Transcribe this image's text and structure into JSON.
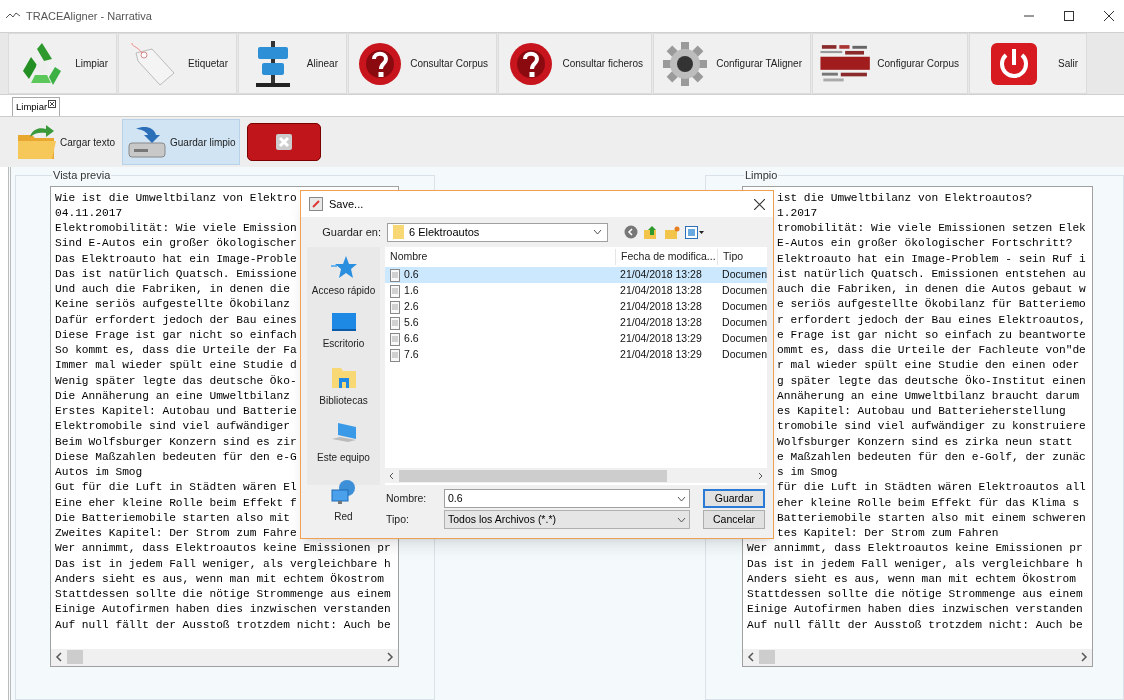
{
  "window": {
    "title": "TRACEAligner - Narrativa"
  },
  "toolbar": [
    {
      "label": "Limpiar",
      "kind": "recycle"
    },
    {
      "label": "Etiquetar",
      "kind": "tag"
    },
    {
      "label": "Alinear",
      "kind": "align"
    },
    {
      "label": "Consultar Corpus",
      "kind": "question"
    },
    {
      "label": "Consultar ficheros",
      "kind": "question"
    },
    {
      "label": "Configurar TAligner",
      "kind": "gear"
    },
    {
      "label": "Configurar Corpus",
      "kind": "cloud"
    },
    {
      "label": "Salir",
      "kind": "power"
    }
  ],
  "tabs": [
    {
      "label": "Limpiar",
      "selected": true
    }
  ],
  "actions": [
    {
      "label": "Cargar texto",
      "kind": "load",
      "selected": false
    },
    {
      "label": "Guardar limpio",
      "kind": "save",
      "selected": true
    },
    {
      "kind": "delete",
      "selected": false
    }
  ],
  "preview": {
    "title": "Vista previa",
    "lines_beside_dialog": [
      "Wie ist die Umweltbilanz von Elektro",
      "04.11.2017",
      "Elektromobilität: Wie viele Emission",
      "Sind E-Autos ein großer ökologischer",
      "Das Elektroauto hat ein Image-Proble",
      "Das ist natürlich Quatsch. Emissione",
      "Und auch die Fabriken, in denen die",
      "Keine seriös aufgestellte Ökobilanz",
      "Dafür erfordert jedoch der Bau eines",
      "Diese Frage ist gar nicht so einfach",
      "So kommt es, dass die Urteile der Fa",
      "Immer mal wieder spült eine Studie d",
      "Wenig später legte das deutsche Öko-",
      "Die Annäherung an eine Umweltbilanz",
      "Erstes Kapitel: Autobau und Batterie",
      "Elektromobile sind viel aufwändiger",
      "Beim Wolfsburger Konzern sind es zir",
      "Diese Maßzahlen bedeuten für den e-G",
      "Autos im Smog",
      "Gut für die Luft in Städten wären El",
      "Eine eher kleine Rolle beim Effekt f",
      "Die Batteriemobile starten also mit",
      "Zweites Kapitel: Der Strom zum Fahre"
    ],
    "lines_below_dialog": [
      "Wer annimmt, dass Elektroautos keine Emissionen pr",
      "Das ist in jedem Fall weniger, als vergleichbare h",
      "Anders sieht es aus, wenn man mit echtem Ökostrom",
      "Stattdessen sollte die nötige Strommenge aus einem",
      "Einige Autofirmen haben dies inzwischen verstanden",
      "Auf null fällt der Ausstoß trotzdem nicht: Auch be"
    ]
  },
  "clean": {
    "title": "Limpio",
    "lines_beside_dialog": [
      "ist die Umweltbilanz von Elektroautos?",
      "1.2017",
      "tromobilität: Wie viele Emissionen setzen Elek",
      "E-Autos ein großer ökologischer Fortschritt?",
      "Elektroauto hat ein Image-Problem - sein Ruf i",
      "ist natürlich Quatsch. Emissionen entstehen au",
      "auch die Fabriken, in denen die Autos gebaut w",
      "e seriös aufgestellte Ökobilanz für Batteriemo",
      "r erfordert jedoch der Bau eines Elektroautos,",
      "e Frage ist gar nicht so einfach zu beantworte",
      "ommt es, dass die Urteile der Fachleute von\"de",
      "r mal wieder spült eine Studie den einen oder",
      "g später legte das deutsche Öko-Institut einen",
      "Annäherung an eine Umweltbilanz braucht darum",
      "es Kapitel: Autobau und Batterieherstellung",
      "tromobile sind viel aufwändiger zu konstruiere",
      "Wolfsburger Konzern sind es zirka neun statt",
      "e Maßzahlen bedeuten für den e-Golf, der zunäc",
      "s im Smog",
      "für die Luft in Städten wären Elektroautos all",
      "eher kleine Rolle beim Effekt für das Klima s",
      "Batteriemobile starten also mit einem schweren",
      "tes Kapitel: Der Strom zum Fahren"
    ],
    "lines_below_dialog": [
      "Wer annimmt, dass Elektroautos keine Emissionen pr",
      "Das ist in jedem Fall weniger, als vergleichbare h",
      "Anders sieht es aus, wenn man mit echtem Ökostrom",
      "Stattdessen sollte die nötige Strommenge aus einem",
      "Einige Autofirmen haben dies inzwischen verstanden",
      "Auf null fällt der Ausstoß trotzdem nicht: Auch be"
    ]
  },
  "dialog": {
    "title": "Save...",
    "save_in_label": "Guardar en:",
    "folder": "6 Elektroautos",
    "places": [
      {
        "label": "Acceso rápido",
        "kind": "star"
      },
      {
        "label": "Escritorio",
        "kind": "desktop"
      },
      {
        "label": "Bibliotecas",
        "kind": "library"
      },
      {
        "label": "Este equipo",
        "kind": "computer"
      },
      {
        "label": "Red",
        "kind": "network"
      }
    ],
    "columns": [
      "Nombre",
      "Fecha de modifica...",
      "Tipo"
    ],
    "files": [
      {
        "name": "0.6",
        "date": "21/04/2018 13:28",
        "type": "Documen",
        "selected": true
      },
      {
        "name": "1.6",
        "date": "21/04/2018 13:28",
        "type": "Documen",
        "selected": false
      },
      {
        "name": "2.6",
        "date": "21/04/2018 13:28",
        "type": "Documen",
        "selected": false
      },
      {
        "name": "5.6",
        "date": "21/04/2018 13:28",
        "type": "Documen",
        "selected": false
      },
      {
        "name": "6.6",
        "date": "21/04/2018 13:29",
        "type": "Documen",
        "selected": false
      },
      {
        "name": "7.6",
        "date": "21/04/2018 13:29",
        "type": "Documen",
        "selected": false
      }
    ],
    "name_label": "Nombre:",
    "name_value": "0.6",
    "type_label": "Tipo:",
    "type_value": "Todos los Archivos (*.*)",
    "buttons": [
      "Guardar",
      "Cancelar"
    ]
  }
}
